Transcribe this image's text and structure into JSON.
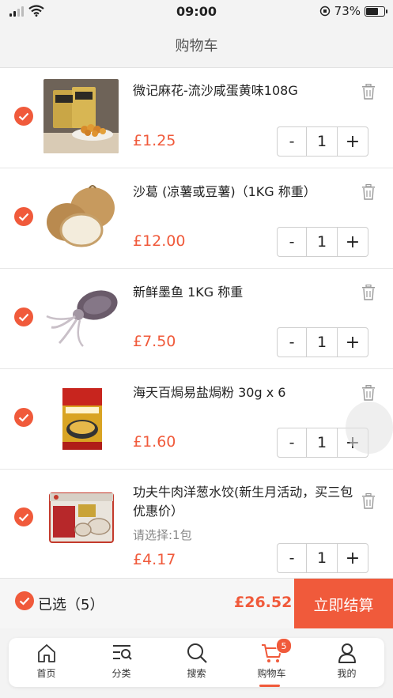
{
  "status_bar": {
    "time": "09:00",
    "battery": "73%",
    "battery_level": 0.73
  },
  "header": {
    "title": "购物车"
  },
  "items": [
    {
      "name": "微记麻花-流沙咸蛋黄味108G",
      "price": "£1.25",
      "qty": "1",
      "option": "",
      "checked": true,
      "image": "snack-bag-image"
    },
    {
      "name": "沙葛 (凉薯或豆薯)（1KG 称重）",
      "price": "£12.00",
      "qty": "1",
      "option": "",
      "checked": true,
      "image": "jicama-image"
    },
    {
      "name": "新鲜墨鱼 1KG 称重",
      "price": "£7.50",
      "qty": "1",
      "option": "",
      "checked": true,
      "image": "cuttlefish-image"
    },
    {
      "name": "海天百焗易盐焗粉 30g x 6",
      "price": "£1.60",
      "qty": "1",
      "option": "",
      "checked": true,
      "image": "seasoning-box-image"
    },
    {
      "name": "功夫牛肉洋葱水饺(新生月活动，买三包优惠价）",
      "price": "£4.17",
      "qty": "1",
      "option": "请选择:1包",
      "checked": true,
      "image": "dumpling-pack-image"
    }
  ],
  "stepper": {
    "minus": "-",
    "plus": "+"
  },
  "checkout": {
    "selected_label": "已选（5）",
    "total": "£26.52",
    "button": "立即结算"
  },
  "tabs": [
    {
      "label": "首页",
      "icon": "home-icon"
    },
    {
      "label": "分类",
      "icon": "category-icon"
    },
    {
      "label": "搜索",
      "icon": "search-icon"
    },
    {
      "label": "购物车",
      "icon": "cart-icon",
      "badge": "5",
      "active": true
    },
    {
      "label": "我的",
      "icon": "profile-icon"
    }
  ],
  "colors": {
    "accent": "#f05a3b",
    "background": "#f3f3f3"
  }
}
